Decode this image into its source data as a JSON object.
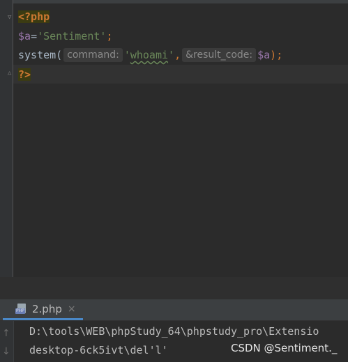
{
  "editor": {
    "line1": {
      "tag": "<?php"
    },
    "line2": {
      "var": "$a",
      "eq": "=",
      "str": "'Sentiment'",
      "semi": ";"
    },
    "line3": {
      "func": "system(",
      "hint1": "command:",
      "arg1": "'whoami'",
      "comma": ",",
      "hint2": "&result_code:",
      "arg2": "$a",
      "close": ");"
    },
    "line4": {
      "tag": "?>"
    }
  },
  "run": {
    "tab_label": "2.php",
    "tab_close": "×",
    "file_icon_badge": "PHP"
  },
  "console": {
    "lines": [
      "D:\\tools\\WEB\\phpStudy_64\\phpstudy_pro\\Extensio",
      "desktop-6ck5ivt\\del'l'"
    ],
    "up_arrow": "↑",
    "down_arrow": "↓"
  },
  "watermark": "CSDN @Sentiment._"
}
